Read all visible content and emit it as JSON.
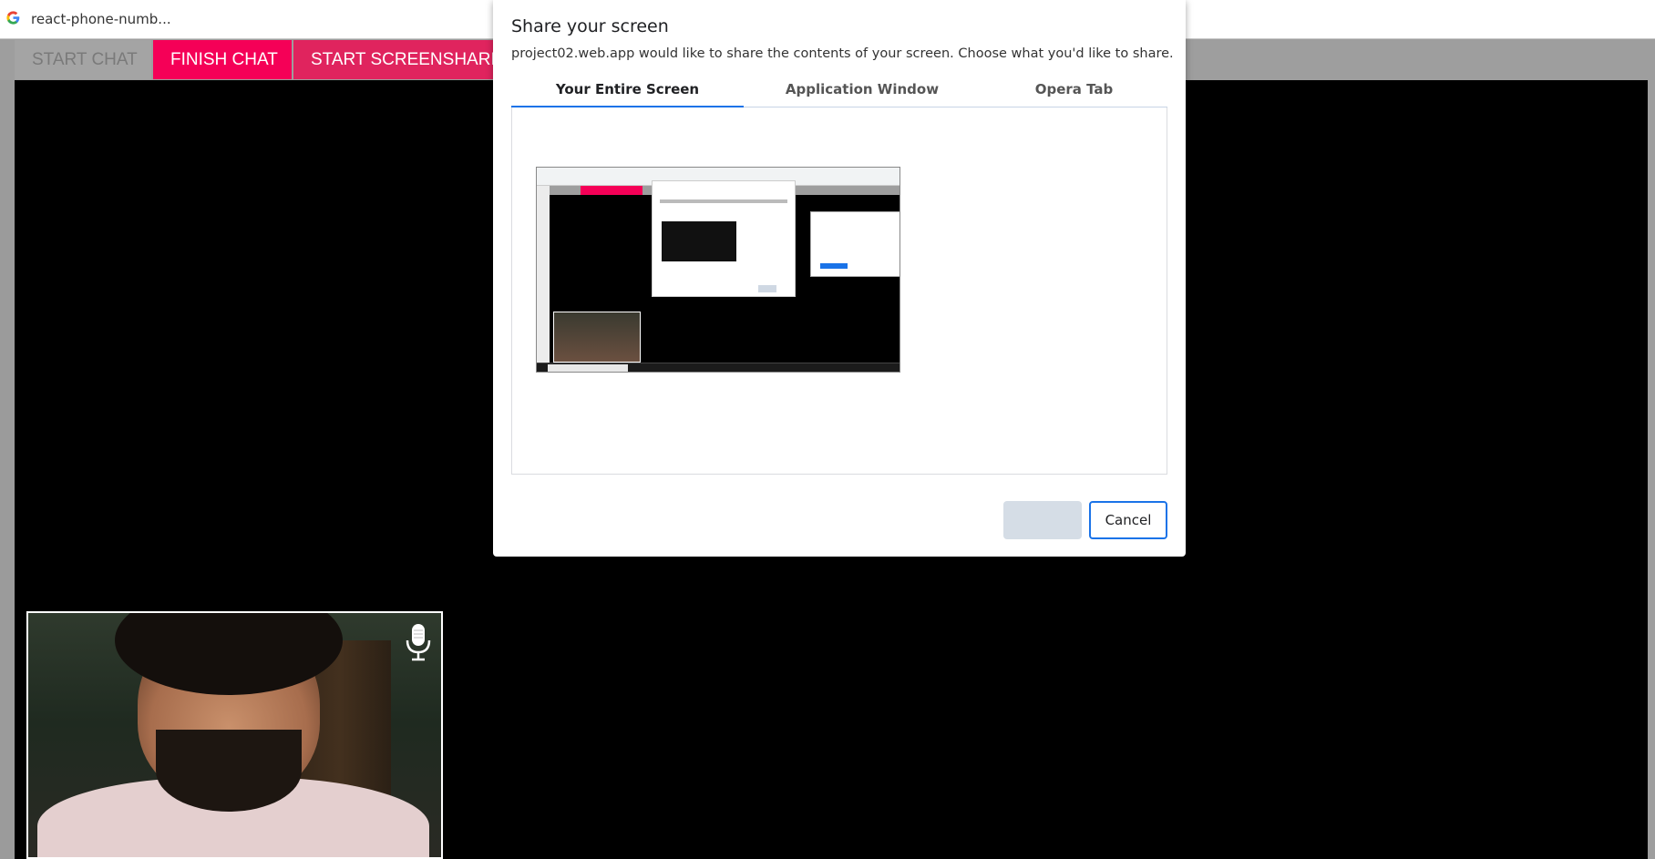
{
  "browser": {
    "tab_title": "react-phone-numb..."
  },
  "toolbar": {
    "start_chat_label": "START CHAT",
    "finish_chat_label": "FINISH CHAT",
    "start_screensharing_label": "START SCREENSHARI",
    "accent_color": "#f50057"
  },
  "dialog": {
    "title": "Share your screen",
    "message": "project02.web.app would like to share the contents of your screen. Choose what you'd like to share.",
    "tabs": [
      {
        "label": "Your Entire Screen",
        "selected": true
      },
      {
        "label": "Application Window",
        "selected": false
      },
      {
        "label": "Opera Tab",
        "selected": false
      }
    ],
    "share_label": "",
    "cancel_label": "Cancel",
    "accent_color": "#1a73e8"
  },
  "video": {
    "local_mic_icon": "microphone-icon"
  }
}
